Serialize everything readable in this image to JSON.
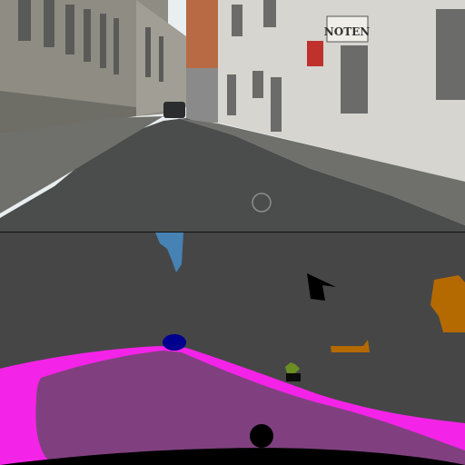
{
  "photo": {
    "shop_sign_text": "NOTEN",
    "colors": {
      "sky": "#e9eef0",
      "left_building": "#8f8d83",
      "left_building_shadow": "#6f6e66",
      "orange_building": "#b86a45",
      "right_building": "#d6d5cf",
      "road": "#4b4d4c",
      "sidewalk": "#6f706c",
      "car": "#2a2c2e"
    }
  },
  "segmentation": {
    "colors": {
      "background": "#464646",
      "road": "#80407f",
      "sidewalk": "#f423e8",
      "car": "#00008e",
      "sky": "#4682b4",
      "vegetation": "#6b8e23",
      "traffic_sign": "#dcdc00",
      "pole": "#999999",
      "ego_vehicle": "#000000",
      "object_brown": "#b46a00",
      "object_black": "#000000"
    }
  }
}
